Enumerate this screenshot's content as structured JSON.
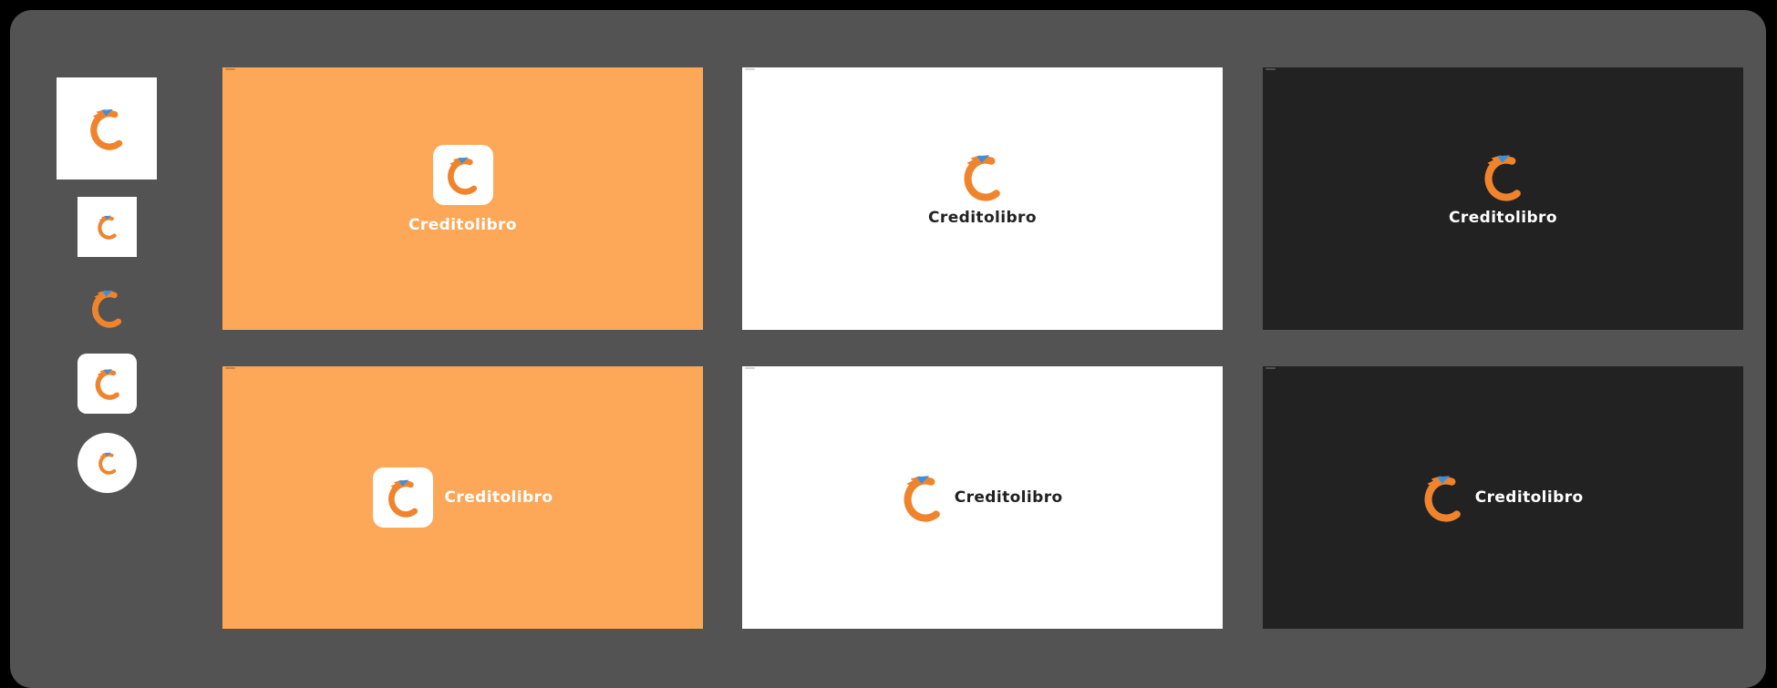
{
  "brand": {
    "name": "Creditolibro",
    "colors": {
      "orange": "#f0842c",
      "blue": "#3f8fd8",
      "artboard_orange": "#fda758",
      "artboard_white": "#ffffff",
      "artboard_dark": "#222222",
      "board_gray": "#535353"
    }
  },
  "icon_variants": [
    {
      "name": "square-large",
      "icon": "c-logo-icon"
    },
    {
      "name": "square-small",
      "icon": "c-logo-icon"
    },
    {
      "name": "plain",
      "icon": "c-logo-icon"
    },
    {
      "name": "rounded-square",
      "icon": "c-logo-icon"
    },
    {
      "name": "circle",
      "icon": "c-logo-icon"
    }
  ],
  "artboards": [
    {
      "background": "orange",
      "layout": "stacked",
      "badge": true,
      "label": "Creditolibro"
    },
    {
      "background": "white",
      "layout": "stacked",
      "badge": false,
      "label": "Creditolibro"
    },
    {
      "background": "dark",
      "layout": "stacked",
      "badge": false,
      "label": "Creditolibro"
    },
    {
      "background": "orange",
      "layout": "horizontal",
      "badge": true,
      "label": "Creditolibro"
    },
    {
      "background": "white",
      "layout": "horizontal",
      "badge": false,
      "label": "Creditolibro"
    },
    {
      "background": "dark",
      "layout": "horizontal",
      "badge": false,
      "label": "Creditolibro"
    }
  ]
}
